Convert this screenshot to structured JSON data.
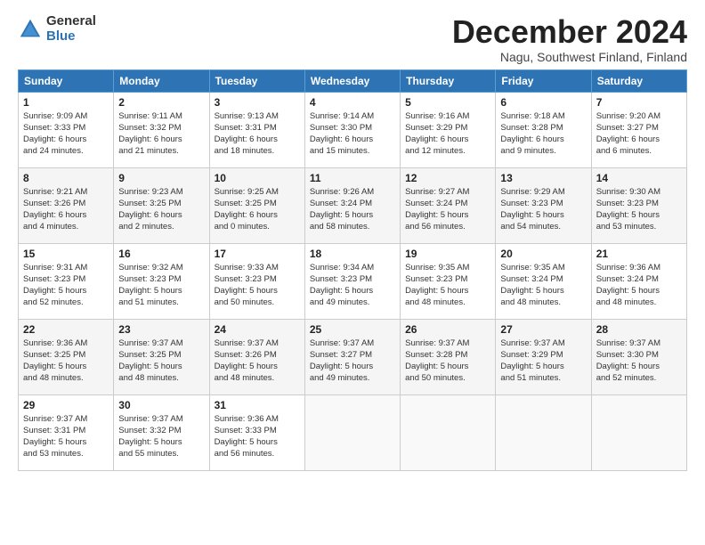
{
  "logo": {
    "general": "General",
    "blue": "Blue"
  },
  "title": "December 2024",
  "subtitle": "Nagu, Southwest Finland, Finland",
  "days_header": [
    "Sunday",
    "Monday",
    "Tuesday",
    "Wednesday",
    "Thursday",
    "Friday",
    "Saturday"
  ],
  "weeks": [
    [
      {
        "day": "1",
        "info": "Sunrise: 9:09 AM\nSunset: 3:33 PM\nDaylight: 6 hours\nand 24 minutes."
      },
      {
        "day": "2",
        "info": "Sunrise: 9:11 AM\nSunset: 3:32 PM\nDaylight: 6 hours\nand 21 minutes."
      },
      {
        "day": "3",
        "info": "Sunrise: 9:13 AM\nSunset: 3:31 PM\nDaylight: 6 hours\nand 18 minutes."
      },
      {
        "day": "4",
        "info": "Sunrise: 9:14 AM\nSunset: 3:30 PM\nDaylight: 6 hours\nand 15 minutes."
      },
      {
        "day": "5",
        "info": "Sunrise: 9:16 AM\nSunset: 3:29 PM\nDaylight: 6 hours\nand 12 minutes."
      },
      {
        "day": "6",
        "info": "Sunrise: 9:18 AM\nSunset: 3:28 PM\nDaylight: 6 hours\nand 9 minutes."
      },
      {
        "day": "7",
        "info": "Sunrise: 9:20 AM\nSunset: 3:27 PM\nDaylight: 6 hours\nand 6 minutes."
      }
    ],
    [
      {
        "day": "8",
        "info": "Sunrise: 9:21 AM\nSunset: 3:26 PM\nDaylight: 6 hours\nand 4 minutes."
      },
      {
        "day": "9",
        "info": "Sunrise: 9:23 AM\nSunset: 3:25 PM\nDaylight: 6 hours\nand 2 minutes."
      },
      {
        "day": "10",
        "info": "Sunrise: 9:25 AM\nSunset: 3:25 PM\nDaylight: 6 hours\nand 0 minutes."
      },
      {
        "day": "11",
        "info": "Sunrise: 9:26 AM\nSunset: 3:24 PM\nDaylight: 5 hours\nand 58 minutes."
      },
      {
        "day": "12",
        "info": "Sunrise: 9:27 AM\nSunset: 3:24 PM\nDaylight: 5 hours\nand 56 minutes."
      },
      {
        "day": "13",
        "info": "Sunrise: 9:29 AM\nSunset: 3:23 PM\nDaylight: 5 hours\nand 54 minutes."
      },
      {
        "day": "14",
        "info": "Sunrise: 9:30 AM\nSunset: 3:23 PM\nDaylight: 5 hours\nand 53 minutes."
      }
    ],
    [
      {
        "day": "15",
        "info": "Sunrise: 9:31 AM\nSunset: 3:23 PM\nDaylight: 5 hours\nand 52 minutes."
      },
      {
        "day": "16",
        "info": "Sunrise: 9:32 AM\nSunset: 3:23 PM\nDaylight: 5 hours\nand 51 minutes."
      },
      {
        "day": "17",
        "info": "Sunrise: 9:33 AM\nSunset: 3:23 PM\nDaylight: 5 hours\nand 50 minutes."
      },
      {
        "day": "18",
        "info": "Sunrise: 9:34 AM\nSunset: 3:23 PM\nDaylight: 5 hours\nand 49 minutes."
      },
      {
        "day": "19",
        "info": "Sunrise: 9:35 AM\nSunset: 3:23 PM\nDaylight: 5 hours\nand 48 minutes."
      },
      {
        "day": "20",
        "info": "Sunrise: 9:35 AM\nSunset: 3:24 PM\nDaylight: 5 hours\nand 48 minutes."
      },
      {
        "day": "21",
        "info": "Sunrise: 9:36 AM\nSunset: 3:24 PM\nDaylight: 5 hours\nand 48 minutes."
      }
    ],
    [
      {
        "day": "22",
        "info": "Sunrise: 9:36 AM\nSunset: 3:25 PM\nDaylight: 5 hours\nand 48 minutes."
      },
      {
        "day": "23",
        "info": "Sunrise: 9:37 AM\nSunset: 3:25 PM\nDaylight: 5 hours\nand 48 minutes."
      },
      {
        "day": "24",
        "info": "Sunrise: 9:37 AM\nSunset: 3:26 PM\nDaylight: 5 hours\nand 48 minutes."
      },
      {
        "day": "25",
        "info": "Sunrise: 9:37 AM\nSunset: 3:27 PM\nDaylight: 5 hours\nand 49 minutes."
      },
      {
        "day": "26",
        "info": "Sunrise: 9:37 AM\nSunset: 3:28 PM\nDaylight: 5 hours\nand 50 minutes."
      },
      {
        "day": "27",
        "info": "Sunrise: 9:37 AM\nSunset: 3:29 PM\nDaylight: 5 hours\nand 51 minutes."
      },
      {
        "day": "28",
        "info": "Sunrise: 9:37 AM\nSunset: 3:30 PM\nDaylight: 5 hours\nand 52 minutes."
      }
    ],
    [
      {
        "day": "29",
        "info": "Sunrise: 9:37 AM\nSunset: 3:31 PM\nDaylight: 5 hours\nand 53 minutes."
      },
      {
        "day": "30",
        "info": "Sunrise: 9:37 AM\nSunset: 3:32 PM\nDaylight: 5 hours\nand 55 minutes."
      },
      {
        "day": "31",
        "info": "Sunrise: 9:36 AM\nSunset: 3:33 PM\nDaylight: 5 hours\nand 56 minutes."
      },
      null,
      null,
      null,
      null
    ]
  ]
}
